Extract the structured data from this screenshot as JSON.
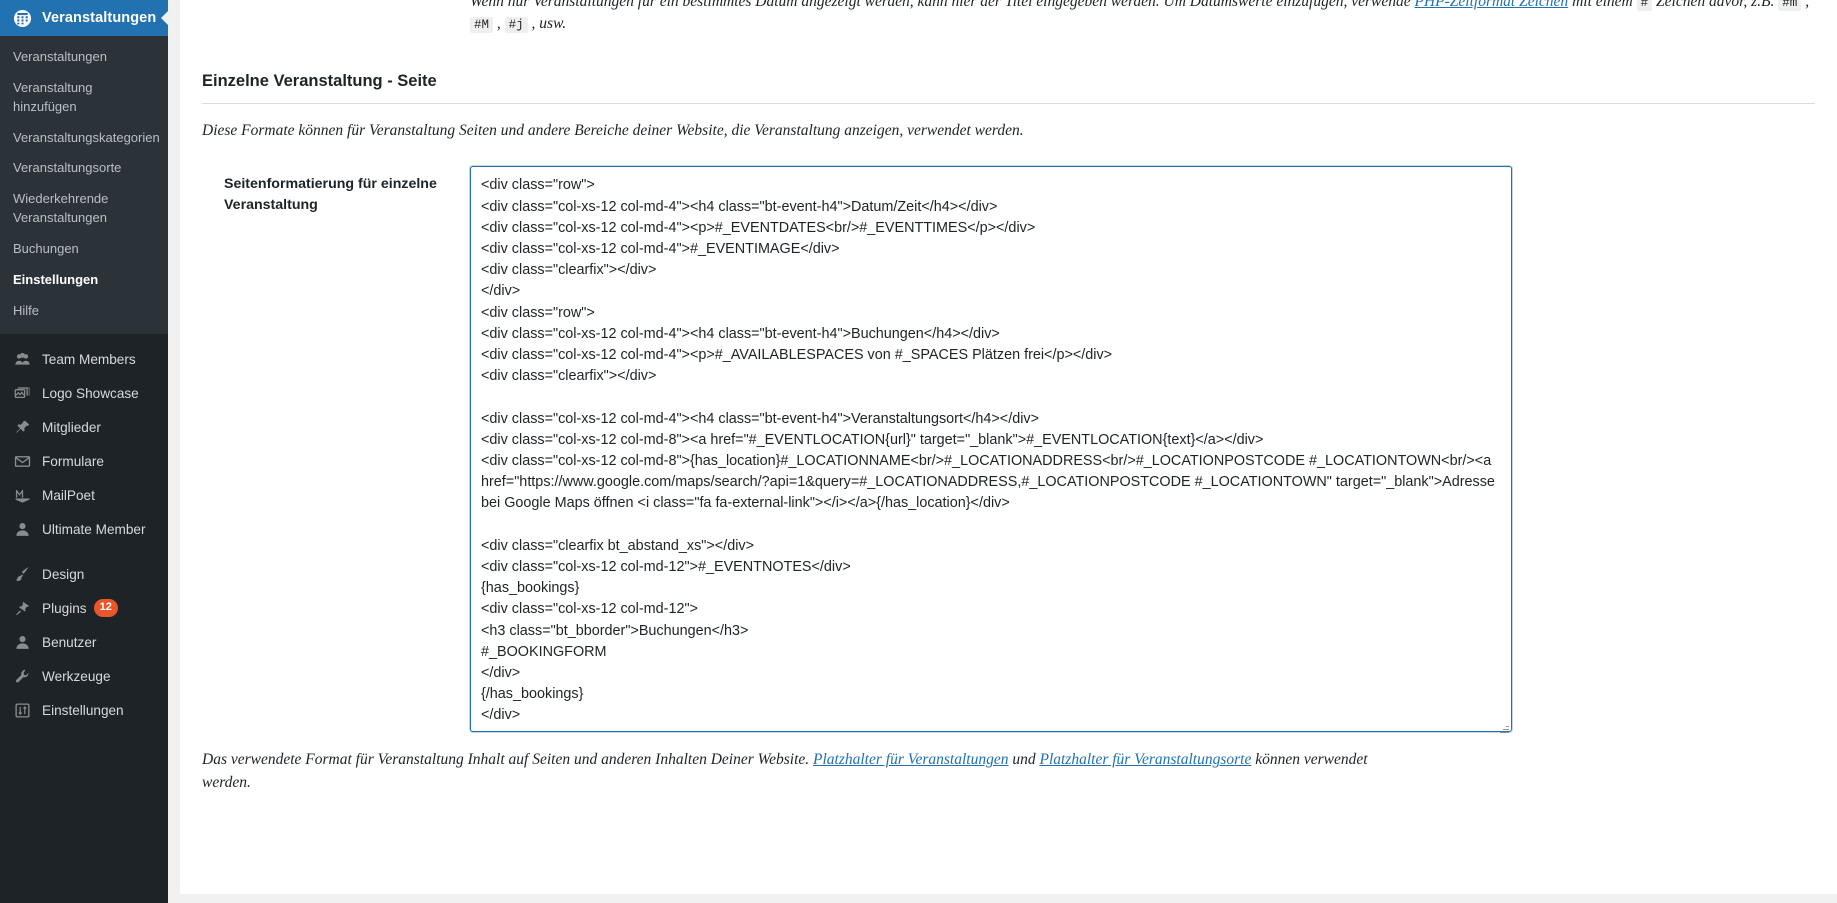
{
  "sidebar": {
    "brand": {
      "label": "Veranstaltungen",
      "icon": "calendar-icon",
      "bg": "#2271b1"
    },
    "submenu": [
      {
        "label": "Veranstaltungen",
        "current": false
      },
      {
        "label": "Veranstaltung hinzufügen",
        "current": false
      },
      {
        "label": "Veranstaltungskategorien",
        "current": false
      },
      {
        "label": "Veranstaltungsorte",
        "current": false
      },
      {
        "label": "Wiederkehrende Veranstaltungen",
        "current": false
      },
      {
        "label": "Buchungen",
        "current": false
      },
      {
        "label": "Einstellungen",
        "current": true
      },
      {
        "label": "Hilfe",
        "current": false
      }
    ],
    "groups": [
      {
        "items": [
          {
            "label": "Team Members",
            "icon": "group-icon",
            "badge": null
          },
          {
            "label": "Logo Showcase",
            "icon": "images-icon",
            "badge": null
          },
          {
            "label": "Mitglieder",
            "icon": "pin-icon",
            "badge": null
          },
          {
            "label": "Formulare",
            "icon": "envelope-icon",
            "badge": null
          },
          {
            "label": "MailPoet",
            "icon": "mailpoet-m-icon",
            "badge": null
          },
          {
            "label": "Ultimate Member",
            "icon": "user-icon",
            "badge": null
          }
        ]
      },
      {
        "items": [
          {
            "label": "Design",
            "icon": "paintbrush-icon",
            "badge": null
          },
          {
            "label": "Plugins",
            "icon": "plug-icon",
            "badge": "12"
          },
          {
            "label": "Benutzer",
            "icon": "user-icon",
            "badge": null
          },
          {
            "label": "Werkzeuge",
            "icon": "wrench-icon",
            "badge": null
          },
          {
            "label": "Einstellungen",
            "icon": "sliders-icon",
            "badge": null
          }
        ]
      }
    ]
  },
  "main": {
    "top_description": {
      "line1_prefix": "Wenn nur Veranstaltungen für ein bestimmtes Datum angezeigt werden, kann hier der Titel eingegeben werden. Um Datumswerte einzufügen, verwende ",
      "link1": "PHP-Zeitformat Zeichen",
      "mid": " mit einem ",
      "code_hash": "#",
      "after_hash": " Zeichen davor, z.B. ",
      "code_m_lower": "#m",
      "sep1": " , ",
      "code_m_upper": "#M",
      "sep2": " , ",
      "code_j": "#j",
      "tail": " , usw."
    },
    "section_title": "Einzelne Veranstaltung - Seite",
    "section_intro": "Diese Formate können für Veranstaltung Seiten und andere Bereiche deiner Website, die Veranstaltung anzeigen, verwendet werden.",
    "field": {
      "label": "Seitenformatierung für einzelne Veranstaltung",
      "textarea_value": "<div class=\"row\">\n<div class=\"col-xs-12 col-md-4\"><h4 class=\"bt-event-h4\">Datum/Zeit</h4></div>\n<div class=\"col-xs-12 col-md-4\"><p>#_EVENTDATES<br/>#_EVENTTIMES</p></div>\n<div class=\"col-xs-12 col-md-4\">#_EVENTIMAGE</div>\n<div class=\"clearfix\"></div>\n</div>\n<div class=\"row\">\n<div class=\"col-xs-12 col-md-4\"><h4 class=\"bt-event-h4\">Buchungen</h4></div>\n<div class=\"col-xs-12 col-md-4\"><p>#_AVAILABLESPACES von #_SPACES Plätzen frei</p></div>\n<div class=\"clearfix\"></div>\n\n<div class=\"col-xs-12 col-md-4\"><h4 class=\"bt-event-h4\">Veranstaltungsort</h4></div>\n<div class=\"col-xs-12 col-md-8\"><a href=\"#_EVENTLOCATION{url}\" target=\"_blank\">#_EVENTLOCATION{text}</a></div>\n<div class=\"col-xs-12 col-md-8\">{has_location}#_LOCATIONNAME<br/>#_LOCATIONADDRESS<br/>#_LOCATIONPOSTCODE #_LOCATIONTOWN<br/><a href=\"https://www.google.com/maps/search/?api=1&query=#_LOCATIONADDRESS,#_LOCATIONPOSTCODE #_LOCATIONTOWN\" target=\"_blank\">Adresse bei Google Maps öffnen <i class=\"fa fa-external-link\"></i></a>{/has_location}</div>\n\n<div class=\"clearfix bt_abstand_xs\"></div>\n<div class=\"col-xs-12 col-md-12\">#_EVENTNOTES</div>\n{has_bookings}\n<div class=\"col-xs-12 col-md-12\">\n<h3 class=\"bt_bborder\">Buchungen</h3>\n#_BOOKINGFORM\n</div>\n{/has_bookings}\n</div>",
      "description_prefix": "Das verwendete Format für Veranstaltung Inhalt auf Seiten und anderen Inhalten Deiner Website. ",
      "description_link1": "Platzhalter für Veranstaltungen",
      "description_mid": " und ",
      "description_link2": "Platzhalter für Veranstaltungsorte",
      "description_suffix": " können verwendet werden."
    }
  },
  "colors": {
    "sidebar_bg": "#1d2327",
    "submenu_bg": "#2c3338",
    "accent": "#2271b1",
    "badge": "#e8562a"
  }
}
